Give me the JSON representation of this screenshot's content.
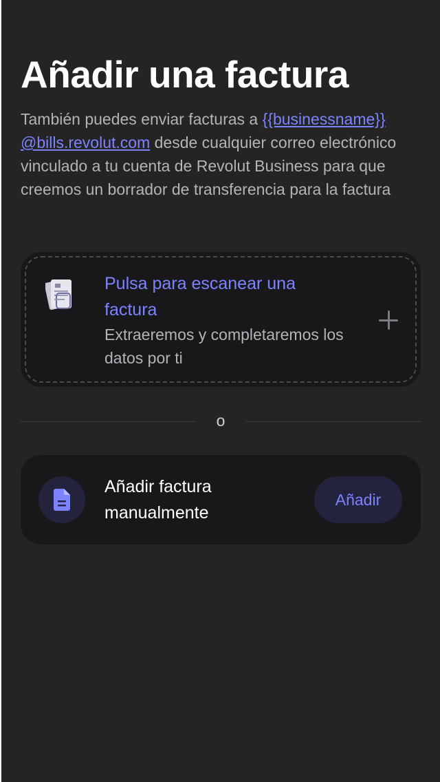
{
  "header": {
    "title": "Añadir una factura"
  },
  "intro": {
    "text_before": "También puedes enviar facturas a ",
    "email_part1": "{{businessname}}",
    "email_part2": "@bills.revolut.com",
    "text_after": " desde cualquier correo electrónico vinculado a tu cuenta de Revolut Business para que creemos un borrador de transferencia para la factura"
  },
  "scan_card": {
    "title": "Pulsa para escanear una factura",
    "subtitle": "Extraeremos y completaremos los datos por ti",
    "icon": "receipt-scan-icon",
    "action_icon": "plus-icon"
  },
  "divider": {
    "label": "o"
  },
  "manual_card": {
    "label": "Añadir factura manualmente",
    "button_label": "Añadir",
    "icon": "document-icon"
  },
  "colors": {
    "background": "#242424",
    "card": "#18181b",
    "accent": "#7d83ff",
    "accent_bg": "#23233d",
    "muted_text": "#b4b4b8"
  }
}
